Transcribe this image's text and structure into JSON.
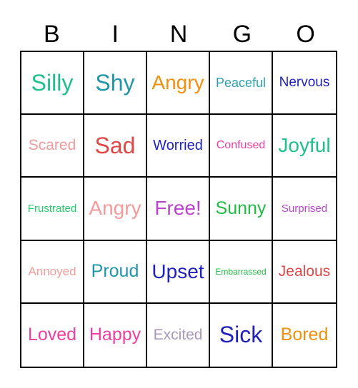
{
  "header": [
    "B",
    "I",
    "N",
    "G",
    "O"
  ],
  "cells": [
    [
      {
        "text": "Silly",
        "color": "#1fbf8f",
        "size": 32
      },
      {
        "text": "Shy",
        "color": "#2196a8",
        "size": 32
      },
      {
        "text": "Angry",
        "color": "#f0900f",
        "size": 28
      },
      {
        "text": "Peaceful",
        "color": "#2aa0b0",
        "size": 18
      },
      {
        "text": "Nervous",
        "color": "#2222bb",
        "size": 19
      }
    ],
    [
      {
        "text": "Scared",
        "color": "#f59a9a",
        "size": 21
      },
      {
        "text": "Sad",
        "color": "#e04848",
        "size": 32
      },
      {
        "text": "Worried",
        "color": "#2222bb",
        "size": 20
      },
      {
        "text": "Confused",
        "color": "#ee3fa0",
        "size": 16
      },
      {
        "text": "Joyful",
        "color": "#1fbf8f",
        "size": 28
      }
    ],
    [
      {
        "text": "Frustrated",
        "color": "#22cc66",
        "size": 15
      },
      {
        "text": "Angry",
        "color": "#f59a9a",
        "size": 28
      },
      {
        "text": "Free!",
        "color": "#bb44cc",
        "size": 28
      },
      {
        "text": "Sunny",
        "color": "#22bb44",
        "size": 25
      },
      {
        "text": "Surprised",
        "color": "#bb44cc",
        "size": 15
      }
    ],
    [
      {
        "text": "Annoyed",
        "color": "#f59a9a",
        "size": 17
      },
      {
        "text": "Proud",
        "color": "#2196a8",
        "size": 25
      },
      {
        "text": "Upset",
        "color": "#2222bb",
        "size": 28
      },
      {
        "text": "Embarrassed",
        "color": "#22bb44",
        "size": 12
      },
      {
        "text": "Jealous",
        "color": "#e04848",
        "size": 21
      }
    ],
    [
      {
        "text": "Loved",
        "color": "#ee3fa0",
        "size": 25
      },
      {
        "text": "Happy",
        "color": "#ee3fa0",
        "size": 25
      },
      {
        "text": "Excited",
        "color": "#a899bb",
        "size": 21
      },
      {
        "text": "Sick",
        "color": "#2222bb",
        "size": 32
      },
      {
        "text": "Bored",
        "color": "#f0900f",
        "size": 25
      }
    ]
  ]
}
